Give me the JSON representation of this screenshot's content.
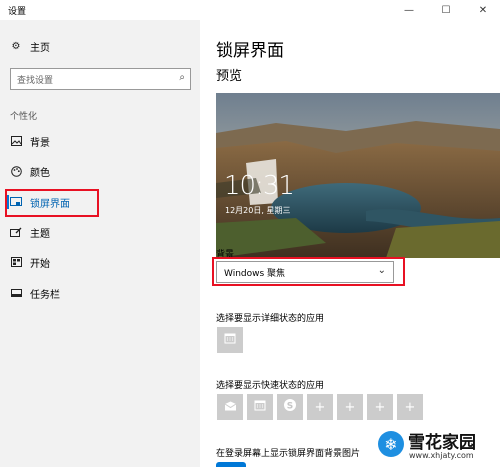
{
  "window": {
    "title": "设置",
    "minimize": "—",
    "maximize": "☐",
    "close": "✕"
  },
  "sidebar": {
    "home": {
      "label": "主页",
      "icon": "gear-icon"
    },
    "search": {
      "placeholder": "查找设置",
      "icon": "search-icon"
    },
    "section": "个性化",
    "items": [
      {
        "label": "背景",
        "icon": "picture-icon"
      },
      {
        "label": "颜色",
        "icon": "palette-icon"
      },
      {
        "label": "锁屏界面",
        "icon": "lock-screen-icon",
        "active": true
      },
      {
        "label": "主题",
        "icon": "theme-brush-icon"
      },
      {
        "label": "开始",
        "icon": "start-grid-icon"
      },
      {
        "label": "任务栏",
        "icon": "taskbar-icon"
      }
    ]
  },
  "main": {
    "title": "锁屏界面",
    "preview_label": "预览",
    "preview": {
      "time": "10:31",
      "date": "12月20日, 星期三"
    },
    "background_label": "背景",
    "background_value": "Windows 聚焦",
    "detailed_status_label": "选择要显示详细状态的应用",
    "quick_status_label": "选择要显示快速状态的应用",
    "signin_label": "在登录屏幕上显示锁屏界面背景图片",
    "quick_tiles": [
      "mail-icon",
      "calendar-icon",
      "skype-icon",
      "plus-icon",
      "plus-icon",
      "plus-icon",
      "plus-icon"
    ]
  },
  "watermark": {
    "title": "雪花家园",
    "url": "www.xhjaty.com"
  },
  "accent_color": "#0078d7",
  "highlight_color": "#e81123"
}
